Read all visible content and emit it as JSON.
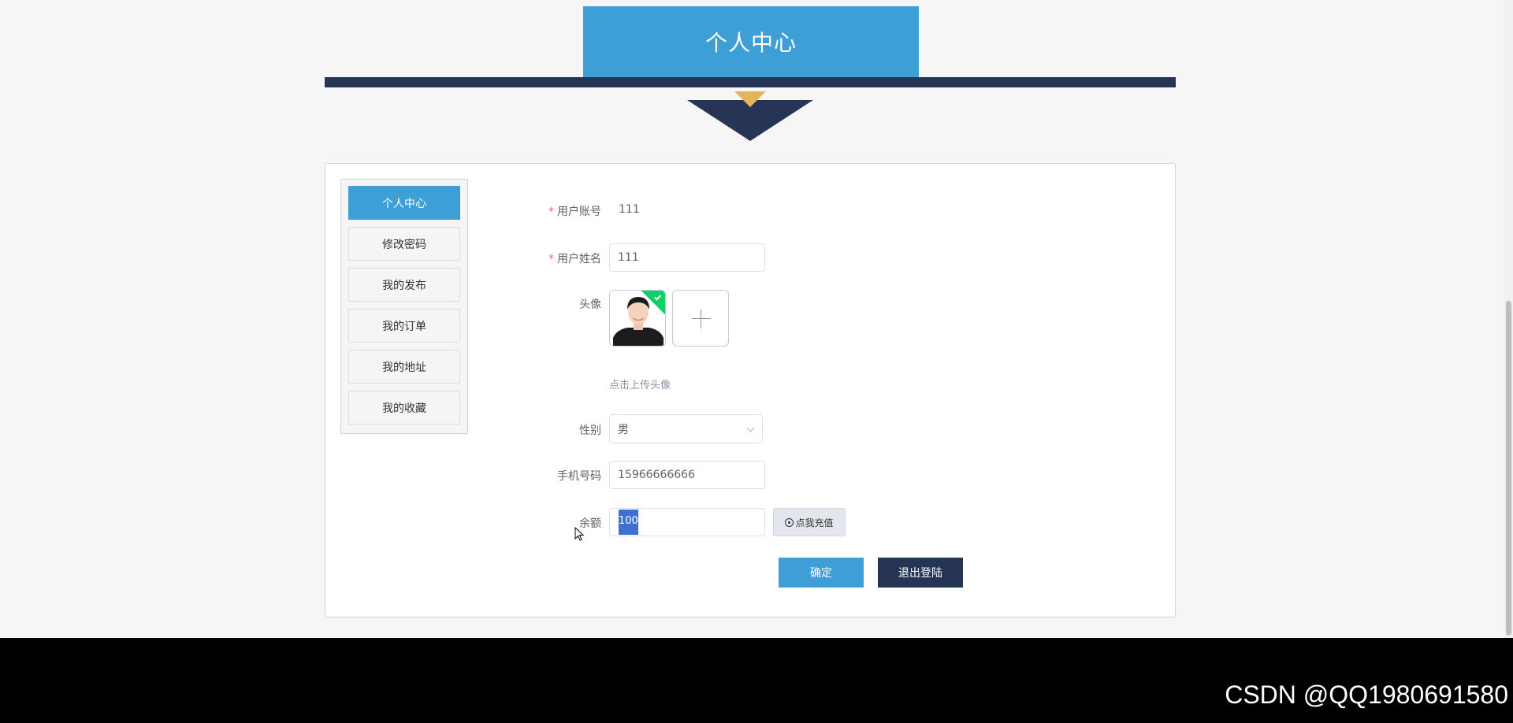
{
  "header": {
    "title": "个人中心"
  },
  "sidebar": {
    "items": [
      {
        "label": "个人中心",
        "active": true
      },
      {
        "label": "修改密码",
        "active": false
      },
      {
        "label": "我的发布",
        "active": false
      },
      {
        "label": "我的订单",
        "active": false
      },
      {
        "label": "我的地址",
        "active": false
      },
      {
        "label": "我的收藏",
        "active": false
      }
    ]
  },
  "form": {
    "account": {
      "label": "用户账号",
      "value": "111",
      "required": true
    },
    "name": {
      "label": "用户姓名",
      "value": "111",
      "required": true
    },
    "avatar": {
      "label": "头像",
      "upload_hint": "点击上传头像"
    },
    "gender": {
      "label": "性别",
      "value": "男"
    },
    "phone": {
      "label": "手机号码",
      "value": "15966666666"
    },
    "balance": {
      "label": "余额",
      "value": "100",
      "recharge_label": "点我充值"
    },
    "required_mark": "*"
  },
  "actions": {
    "confirm_label": "确定",
    "logout_label": "退出登陆"
  },
  "footer": {
    "watermark": "CSDN @QQ1980691580"
  },
  "colors": {
    "accent": "#3e9ed6",
    "navy": "#263456",
    "gold": "#e3b559",
    "success": "#13ce66"
  }
}
